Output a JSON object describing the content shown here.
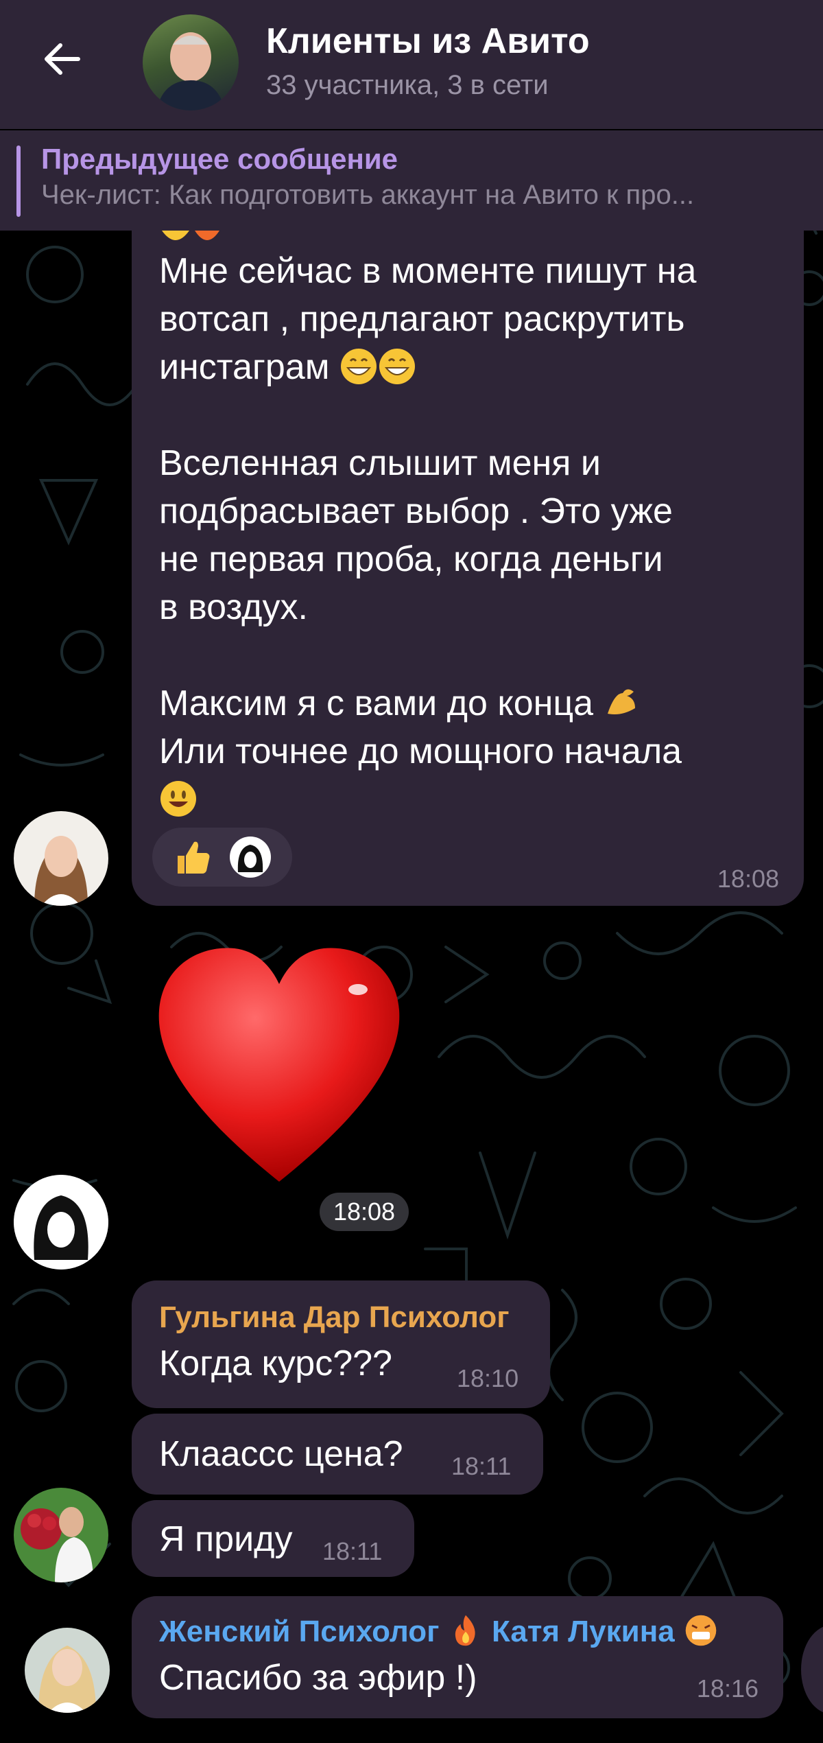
{
  "header": {
    "title": "Клиенты из Авито",
    "subtitle": "33 участника, 3 в сети",
    "back_icon": "arrow-left-icon"
  },
  "pinned": {
    "title": "Предыдущее сообщение",
    "text": "Чек-лист: Как подготовить аккаунт на Авито к про..."
  },
  "messages": {
    "m1": {
      "line1": "Мне сейчас в моменте пишут на",
      "line2": "вотсап , предлагают раскрутить",
      "line3": "инстаграм",
      "line4": "Вселенная слышит меня и",
      "line5": "подбрасывает выбор .  Это уже",
      "line6": "не первая проба, когда  деньги",
      "line7": "в воздух.",
      "line8": "Максим я с вами до конца",
      "line9": "Или точнее до мощного начала",
      "time": "18:08",
      "reactions": [
        "thumbs-up",
        "hooded-avatar"
      ]
    },
    "m2": {
      "sticker": "red-heart",
      "time": "18:08"
    },
    "m3": {
      "sender": "Гульгина Дар Психолог",
      "text": "Когда курс???",
      "time": "18:10"
    },
    "m4": {
      "text": "Клааccс цена?",
      "time": "18:11"
    },
    "m5": {
      "text": "Я приду",
      "time": "18:11"
    },
    "m6": {
      "sender_part1": "Женский Психолог",
      "sender_part2": "Катя Лукина",
      "text": "Спасибо за эфир !)",
      "time": "18:16"
    }
  },
  "colors": {
    "bubble": "#2e2537",
    "header": "#2e2537",
    "accent_purple": "#b795e6",
    "sender_orange": "#e8a64f",
    "sender_blue": "#5aa8f0"
  }
}
